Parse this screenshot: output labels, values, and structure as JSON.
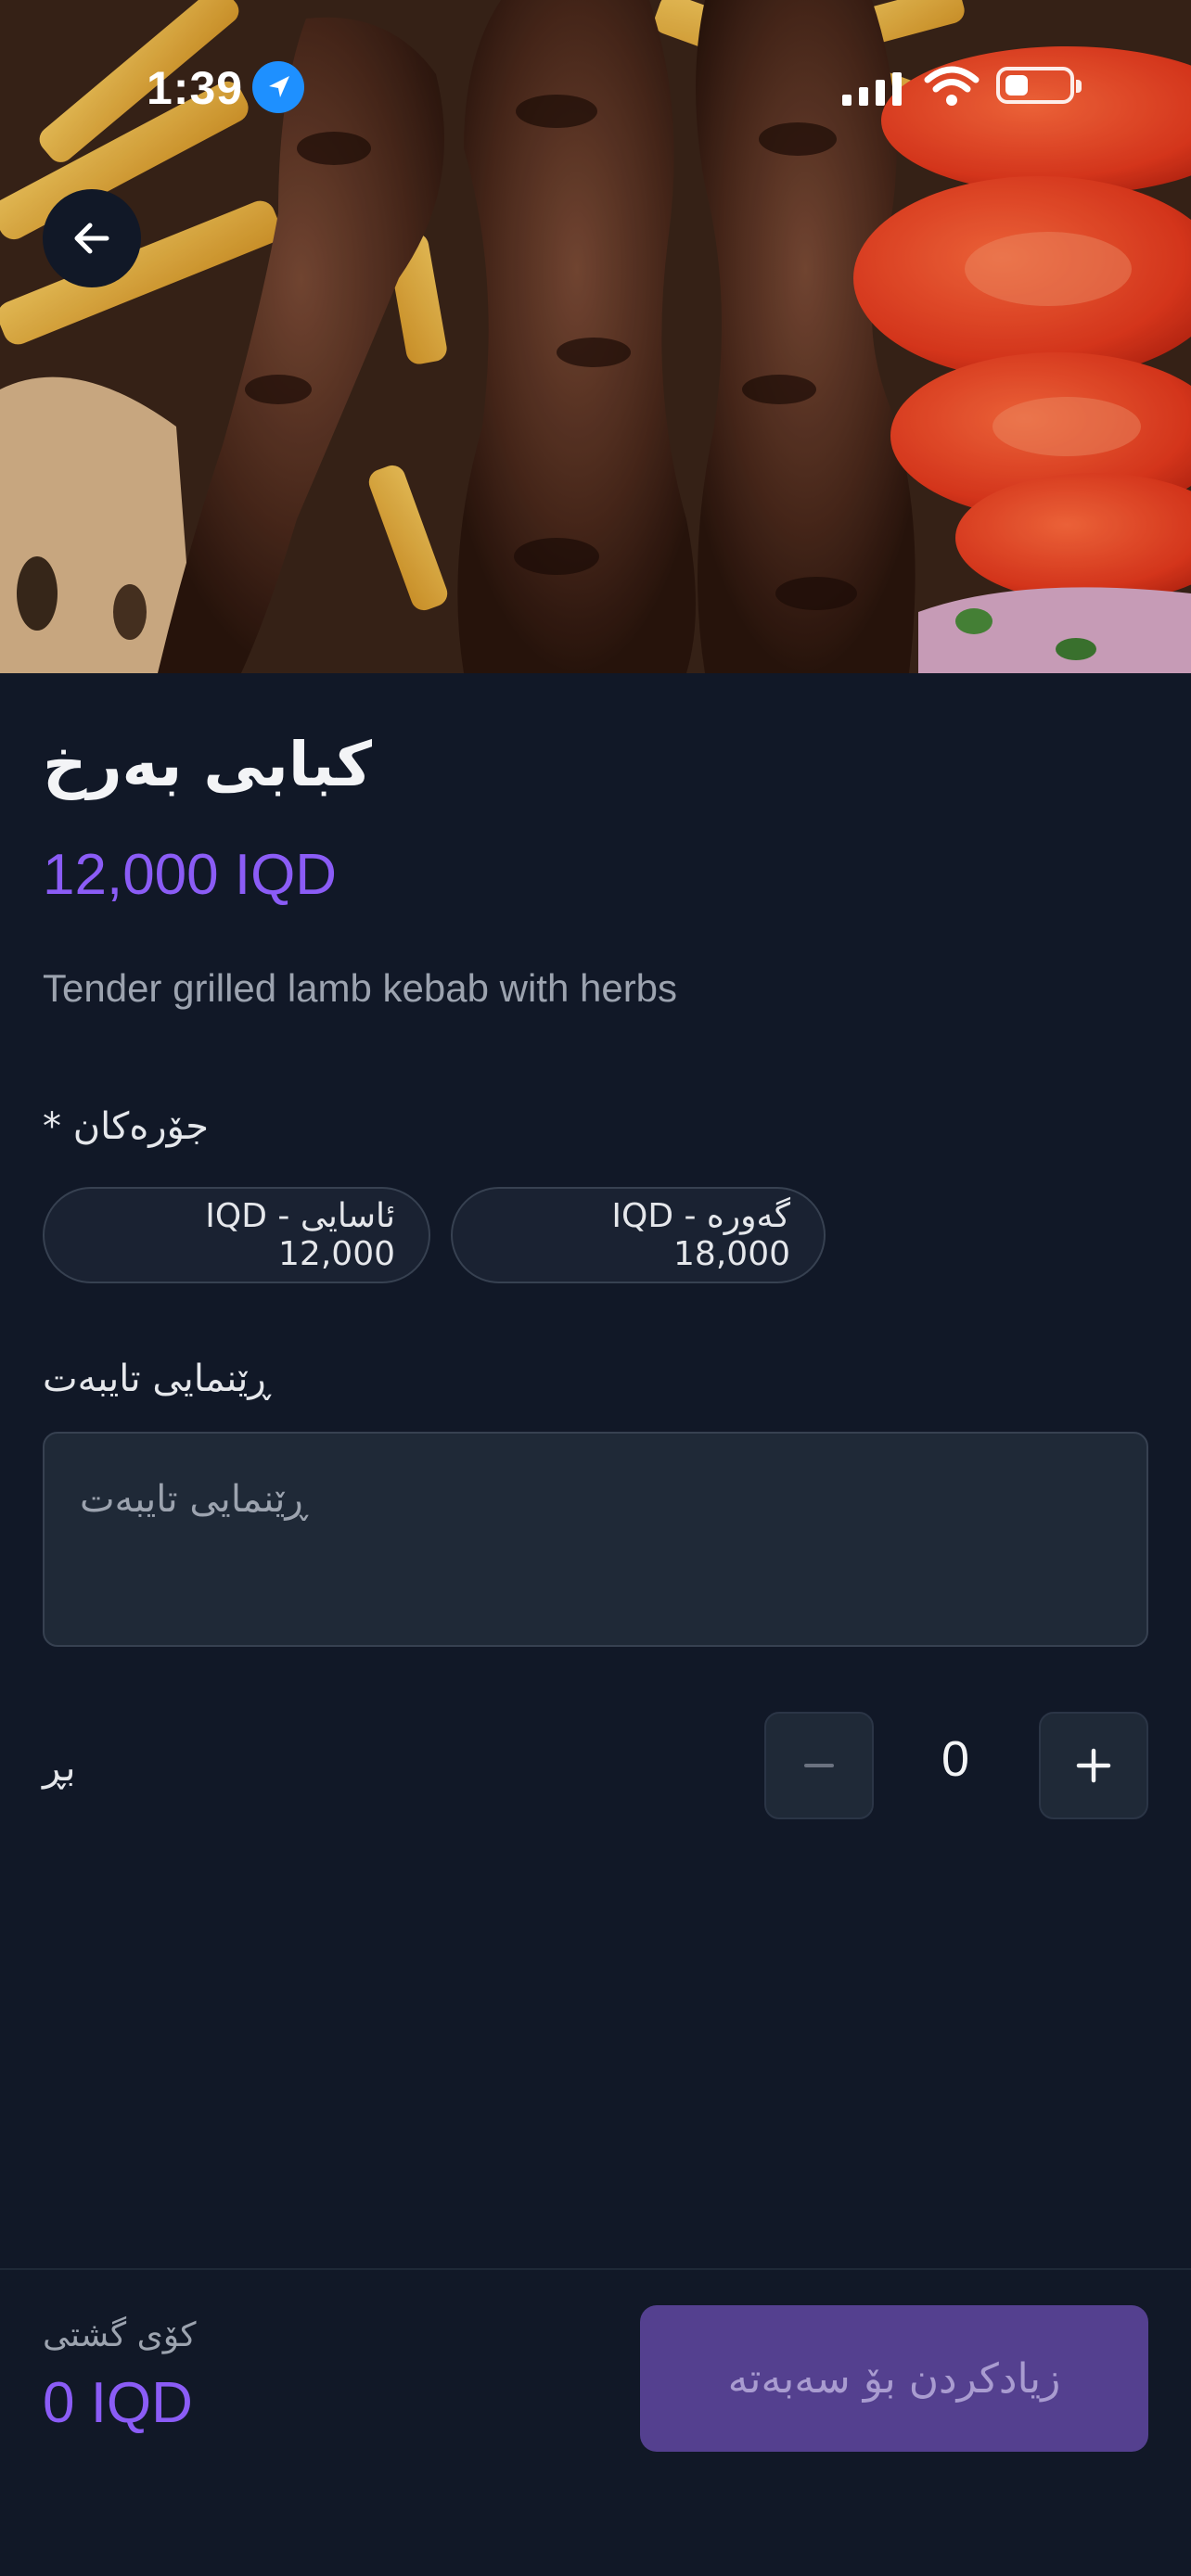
{
  "status_bar": {
    "time": "1:39",
    "icons": [
      "location-arrow-icon",
      "signal-icon",
      "wifi-icon",
      "battery-icon"
    ]
  },
  "hero": {
    "image": "lamb-kebab-photo",
    "back_icon": "arrow-left-icon"
  },
  "product": {
    "name": "كبابی بەرخ",
    "price": "12,000 IQD",
    "description": "Tender grilled lamb kebab with herbs"
  },
  "variants": {
    "label": "جۆرەکان *",
    "options": [
      {
        "label": "ئاسایی - IQD 12,000"
      },
      {
        "label": "گەورە - IQD 18,000"
      }
    ]
  },
  "notes": {
    "label": "ڕێنمایی تایبەت",
    "placeholder": "ڕێنمایی تایبەت"
  },
  "quantity": {
    "label": "بڕ",
    "value": "0",
    "decrement_icon": "minus-icon",
    "increment_icon": "plus-icon"
  },
  "footer": {
    "total_label": "کۆی گشتی",
    "total_value": "0 IQD",
    "add_to_cart_label": "زیادکردن بۆ سەبەتە"
  },
  "colors": {
    "background": "#111827",
    "accent": "#8b5cf6",
    "button_disabled": "#54408f",
    "surface": "#1f2937"
  }
}
